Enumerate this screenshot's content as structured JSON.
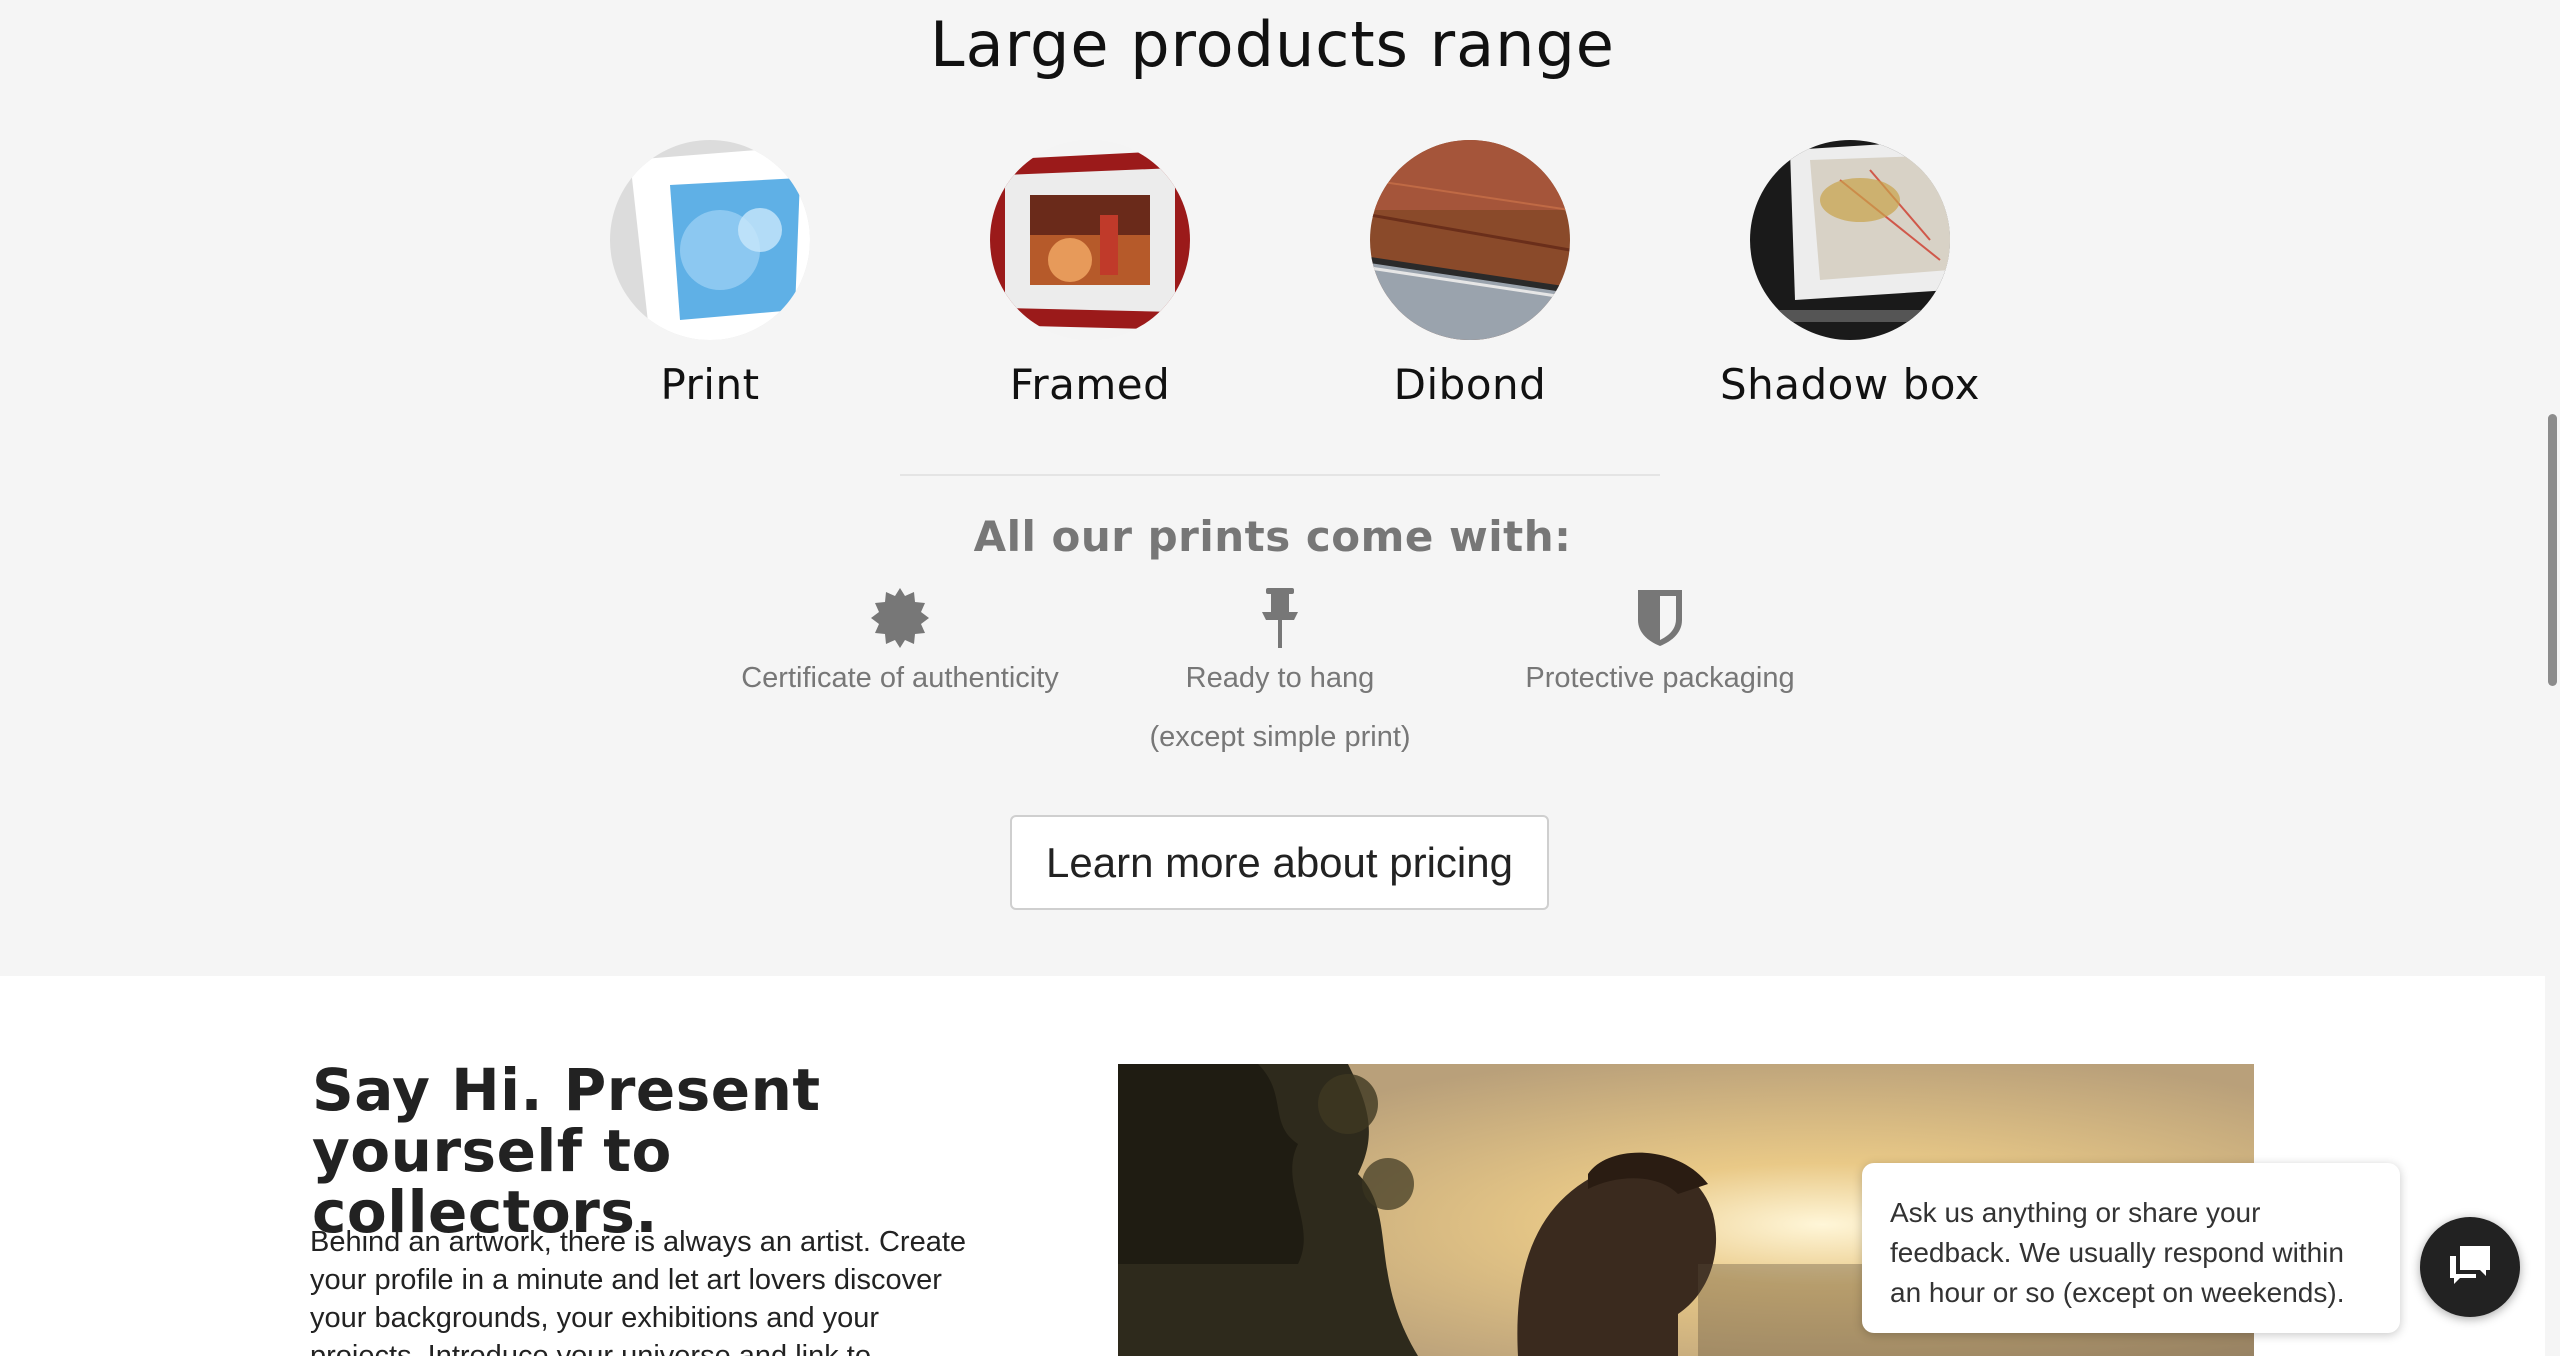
{
  "products": {
    "title": "Large products range",
    "items": [
      {
        "label": "Print"
      },
      {
        "label": "Framed"
      },
      {
        "label": "Dibond"
      },
      {
        "label": "Shadow box"
      }
    ]
  },
  "features": {
    "title": "All our prints come with:",
    "items": [
      {
        "label": "Certificate of authenticity",
        "icon": "badge-icon"
      },
      {
        "label": "Ready to hang",
        "sublabel": "(except simple print)",
        "icon": "pushpin-icon"
      },
      {
        "label": "Protective packaging",
        "icon": "shield-icon"
      }
    ],
    "button_label": "Learn more about pricing"
  },
  "artist": {
    "title": "Say Hi. Present yourself to collectors.",
    "text": "Behind an artwork, there is always an artist. Create your profile in a minute and let art lovers discover your backgrounds, your exhibitions and your projects. Introduce your universe and link to"
  },
  "chat": {
    "message": "Ask us anything or share your feedback. We usually respond within an hour or so (except on weekends).",
    "icon": "chat-icon"
  },
  "colors": {
    "section_bg": "#f5f5f5",
    "muted_text": "#777777",
    "chat_button": "#222222"
  }
}
